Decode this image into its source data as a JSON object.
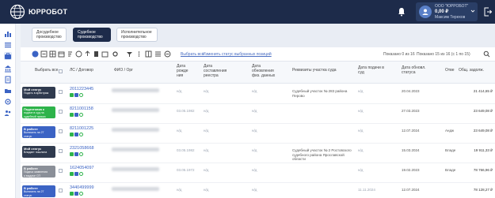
{
  "app": {
    "logo_text": "ЮРРОБОТ"
  },
  "user": {
    "org": "ООО \"ЮРРОБОТ\"",
    "balance": "0,00 ₽",
    "name": "Максим Терехов"
  },
  "tabs": [
    {
      "label": "Досудебное\nпроизводство"
    },
    {
      "label": "Судебное\nпроизводство"
    },
    {
      "label": "Исполнительное\nпроизводство"
    }
  ],
  "toolbar": {
    "select_all": "Выбрать все",
    "change_status": "Изменить статус выбранных позиций",
    "shown_range": "Показано 0 из 16",
    "shown_total": "Показано 15 из 16 (с 1 по 15)"
  },
  "columns": {
    "select_all": "Выбрать все",
    "account": "ЛС / Договор",
    "fio": "ФИО / Орг",
    "birth": "Дата\nрожде\nния",
    "registry": "Дата\nсоставления\nреестра",
    "update_phys": "Дата\nобновления\nфиз. данных",
    "court": "Реквизиты участка суда",
    "filed": "Дата подачи в\nсуд",
    "status_update": "Дата обновл.\nстатуса",
    "other": "Отве",
    "debt": "Общ. задолж."
  },
  "rows": [
    {
      "status": "Мой статус",
      "sub": "Подать в арбитраж",
      "color": "#2f3a4e",
      "account": "2011223445",
      "birth": "н/д",
      "registry": "н/д",
      "update": "н/д",
      "court": "Судебный участок № 283 района\nПерово",
      "filed": "н/д",
      "status_date": "20.04.2023",
      "other": "",
      "debt": "21 414,65 ₽"
    },
    {
      "status": "Подготовка к",
      "sub": "подаче в суд на\nсудебный приказ",
      "color": "#2db34a",
      "account": "8211001158",
      "birth": "03.05.1982",
      "registry": "н/д",
      "update": "н/д",
      "court": "",
      "filed": "н/д",
      "status_date": "27.03.2023",
      "other": "",
      "debt": "23 649,08 ₽"
    },
    {
      "status": "В работе",
      "sub": "Выписать на 27\nстатус",
      "color": "#3b63c4",
      "account": "8211001225",
      "birth": "н/д",
      "registry": "н/д",
      "update": "н/д",
      "court": "",
      "filed": "н/д",
      "status_date": "12.07.2024",
      "other": "Андж",
      "debt": "23 649,08 ₽"
    },
    {
      "status": "Мой статус",
      "sub": "Владает пошлина",
      "color": "#2f3a4e",
      "account": "2321058668",
      "birth": "03.05.1982",
      "registry": "н/д",
      "update": "н/д",
      "court": "Судебный участок № 2 Ростовского\nсудебного района Ярославской\nобласти",
      "filed": "н/д",
      "status_date": "15.03.2024",
      "other": "Владе",
      "debt": "19 911,33 ₽"
    },
    {
      "status": "В работе",
      "sub": "Подача заявления\nо выдаче СП",
      "color": "#8a8f98",
      "account": "1624054097",
      "birth": "03.05.1972",
      "registry": "н/д",
      "update": "н/д",
      "court": "",
      "filed": "н/д",
      "status_date": "19.02.2023",
      "other": "Владе",
      "debt": "78 766,96 ₽"
    },
    {
      "status": "В работе",
      "sub": "Выписать на 27\nстатус",
      "color": "#3b63c4",
      "account": "3440499999",
      "birth": "н/д",
      "registry": "н/д",
      "update": "н/д",
      "court": "",
      "filed": "11.11.2024",
      "status_date": "12.07.2024",
      "other": "",
      "debt": "78 128,27 ₽"
    }
  ]
}
